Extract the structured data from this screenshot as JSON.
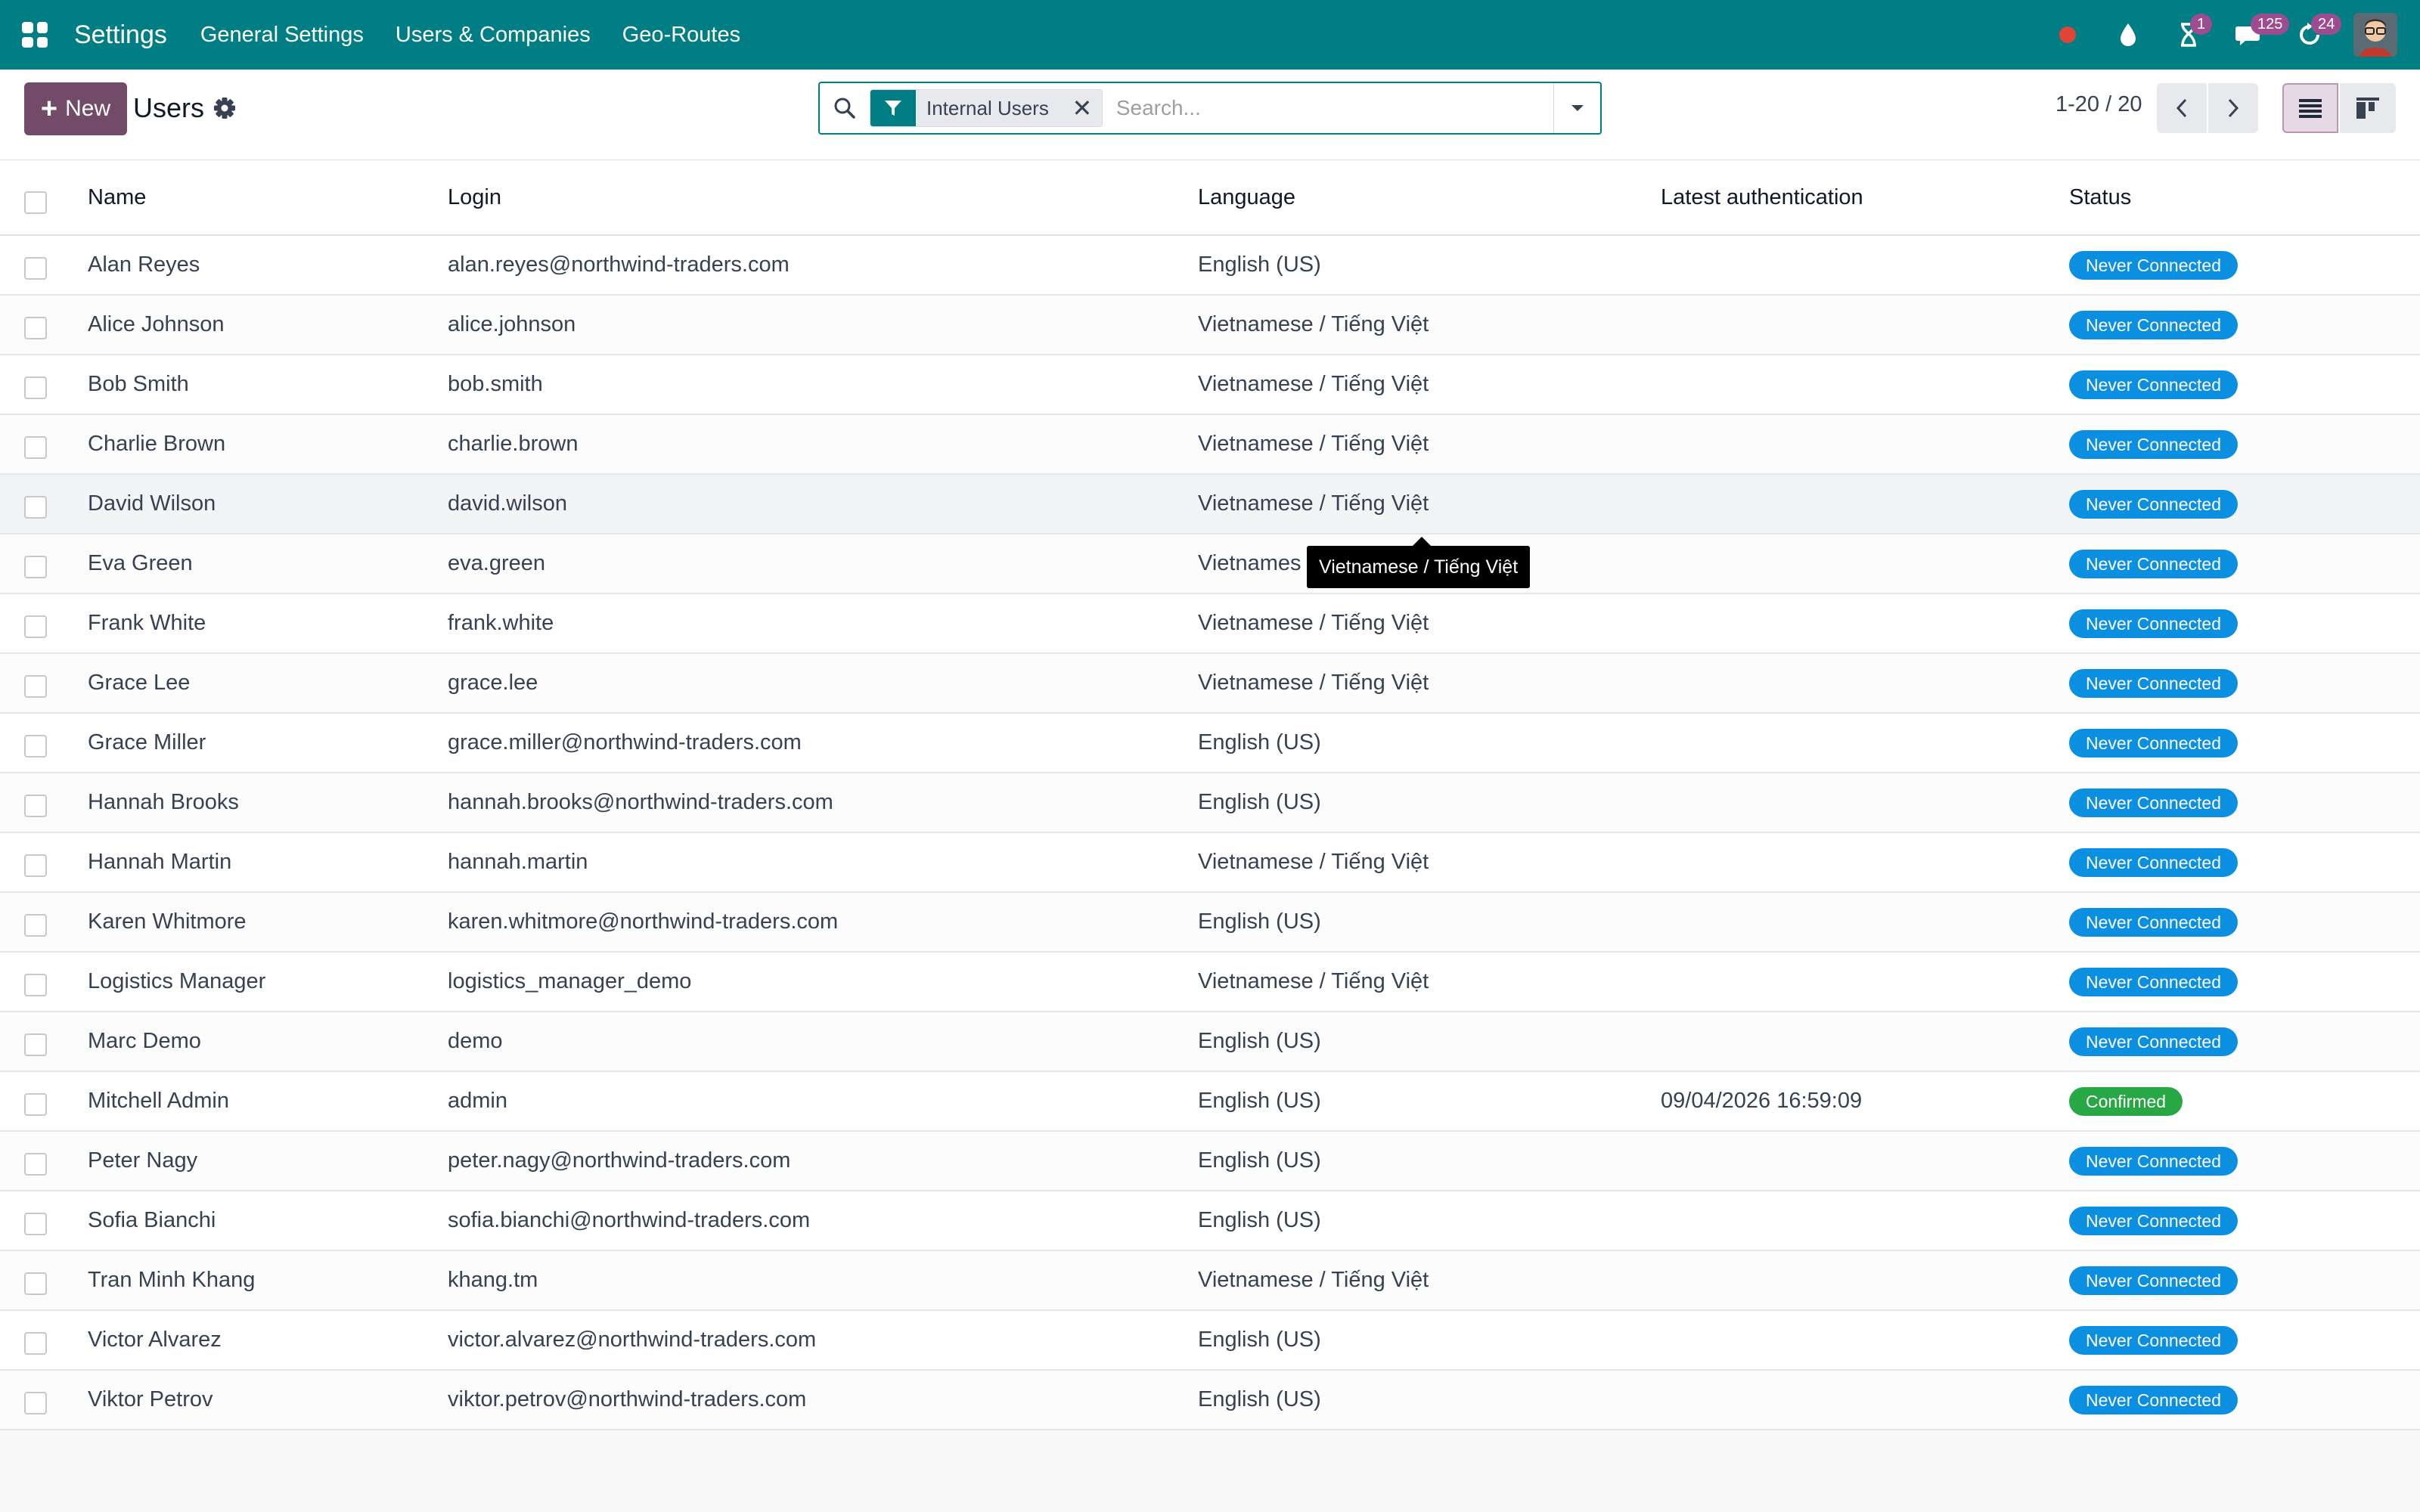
{
  "navbar": {
    "app_name": "Settings",
    "menu": [
      "General Settings",
      "Users & Companies",
      "Geo-Routes"
    ],
    "activity_badge": "1",
    "messages_badge": "125",
    "updates_badge": "24",
    "colors": {
      "bar": "#017e84",
      "badge": "#9c4c8f",
      "record_dot": "#e0453a"
    }
  },
  "control": {
    "new_label": "New",
    "title": "Users",
    "facet_label": "Internal Users",
    "search_placeholder": "Search...",
    "pager": "1-20 / 20"
  },
  "table": {
    "columns": {
      "name": "Name",
      "login": "Login",
      "language": "Language",
      "latest_auth": "Latest authentication",
      "status": "Status"
    },
    "rows": [
      {
        "name": "Alan Reyes",
        "login": "alan.reyes@northwind-traders.com",
        "language": "English (US)",
        "latest_auth": "",
        "status": "Never Connected"
      },
      {
        "name": "Alice Johnson",
        "login": "alice.johnson",
        "language": "Vietnamese / Tiếng Việt",
        "latest_auth": "",
        "status": "Never Connected"
      },
      {
        "name": "Bob Smith",
        "login": "bob.smith",
        "language": "Vietnamese / Tiếng Việt",
        "latest_auth": "",
        "status": "Never Connected"
      },
      {
        "name": "Charlie Brown",
        "login": "charlie.brown",
        "language": "Vietnamese / Tiếng Việt",
        "latest_auth": "",
        "status": "Never Connected"
      },
      {
        "name": "David Wilson",
        "login": "david.wilson",
        "language": "Vietnamese / Tiếng Việt",
        "latest_auth": "",
        "status": "Never Connected"
      },
      {
        "name": "Eva Green",
        "login": "eva.green",
        "language": "Vietnames",
        "latest_auth": "",
        "status": "Never Connected"
      },
      {
        "name": "Frank White",
        "login": "frank.white",
        "language": "Vietnamese / Tiếng Việt",
        "latest_auth": "",
        "status": "Never Connected"
      },
      {
        "name": "Grace Lee",
        "login": "grace.lee",
        "language": "Vietnamese / Tiếng Việt",
        "latest_auth": "",
        "status": "Never Connected"
      },
      {
        "name": "Grace Miller",
        "login": "grace.miller@northwind-traders.com",
        "language": "English (US)",
        "latest_auth": "",
        "status": "Never Connected"
      },
      {
        "name": "Hannah Brooks",
        "login": "hannah.brooks@northwind-traders.com",
        "language": "English (US)",
        "latest_auth": "",
        "status": "Never Connected"
      },
      {
        "name": "Hannah Martin",
        "login": "hannah.martin",
        "language": "Vietnamese / Tiếng Việt",
        "latest_auth": "",
        "status": "Never Connected"
      },
      {
        "name": "Karen Whitmore",
        "login": "karen.whitmore@northwind-traders.com",
        "language": "English (US)",
        "latest_auth": "",
        "status": "Never Connected"
      },
      {
        "name": "Logistics Manager",
        "login": "logistics_manager_demo",
        "language": "Vietnamese / Tiếng Việt",
        "latest_auth": "",
        "status": "Never Connected"
      },
      {
        "name": "Marc Demo",
        "login": "demo",
        "language": "English (US)",
        "latest_auth": "",
        "status": "Never Connected"
      },
      {
        "name": "Mitchell Admin",
        "login": "admin",
        "language": "English (US)",
        "latest_auth": "09/04/2026 16:59:09",
        "status": "Confirmed"
      },
      {
        "name": "Peter Nagy",
        "login": "peter.nagy@northwind-traders.com",
        "language": "English (US)",
        "latest_auth": "",
        "status": "Never Connected"
      },
      {
        "name": "Sofia Bianchi",
        "login": "sofia.bianchi@northwind-traders.com",
        "language": "English (US)",
        "latest_auth": "",
        "status": "Never Connected"
      },
      {
        "name": "Tran Minh Khang",
        "login": "khang.tm",
        "language": "Vietnamese / Tiếng Việt",
        "latest_auth": "",
        "status": "Never Connected"
      },
      {
        "name": "Victor Alvarez",
        "login": "victor.alvarez@northwind-traders.com",
        "language": "English (US)",
        "latest_auth": "",
        "status": "Never Connected"
      },
      {
        "name": "Viktor Petrov",
        "login": "viktor.petrov@northwind-traders.com",
        "language": "English (US)",
        "latest_auth": "",
        "status": "Never Connected"
      }
    ]
  },
  "tooltip": {
    "text": "Vietnamese / Tiếng Việt"
  },
  "status_colors": {
    "Never Connected": "#0b8fe0",
    "Confirmed": "#28a745"
  }
}
